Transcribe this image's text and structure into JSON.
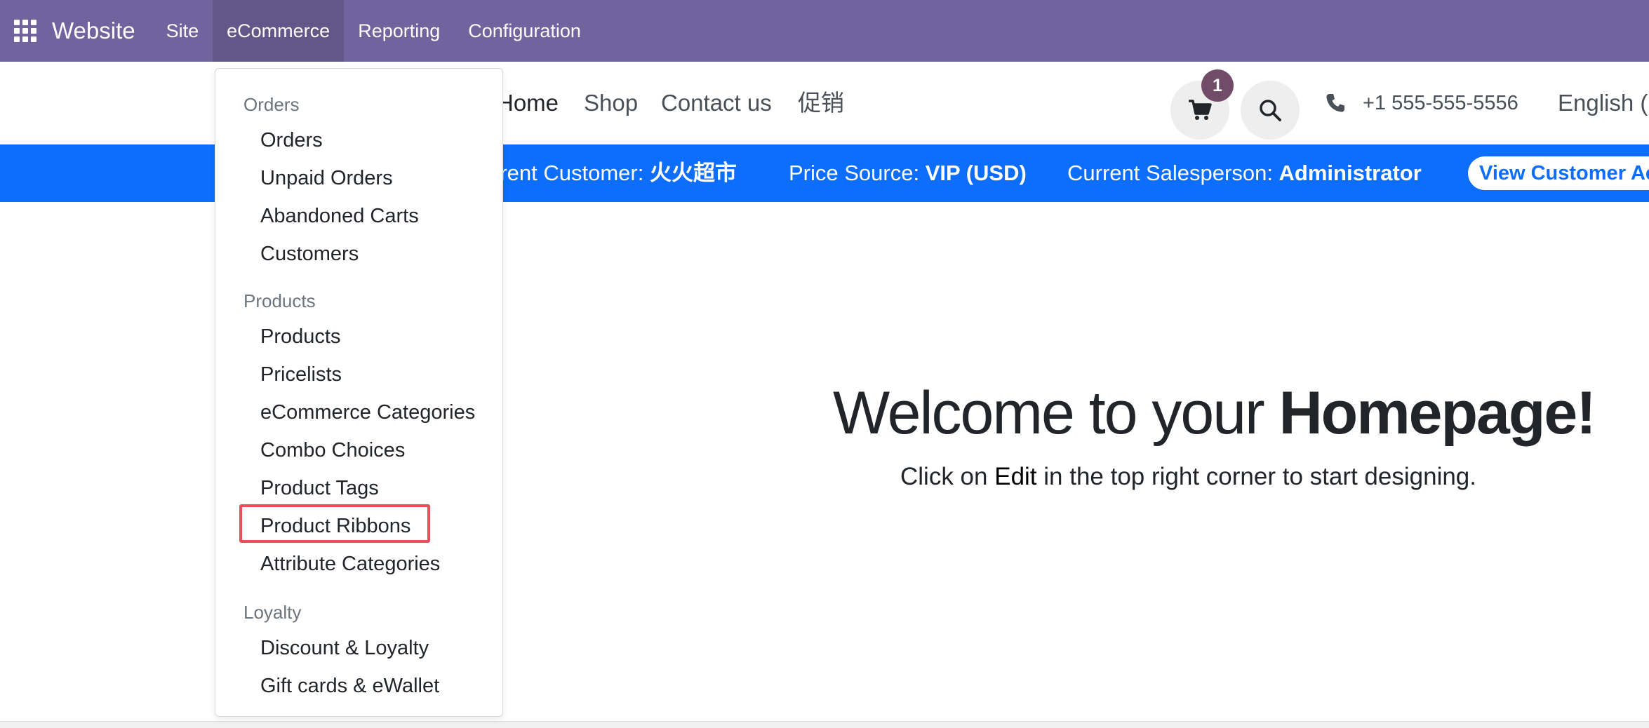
{
  "topbar": {
    "brand": "Website",
    "menus": [
      "Site",
      "eCommerce",
      "Reporting",
      "Configuration"
    ]
  },
  "header": {
    "nav": [
      "Home",
      "Shop",
      "Contact us",
      "促销"
    ],
    "cart_count": "1",
    "phone": "+1 555-555-5556",
    "language": "English ("
  },
  "info_bar": {
    "customer_label": "rrent Customer: ",
    "customer_value": "火火超市",
    "price_label": "Price Source: ",
    "price_value": "VIP (USD)",
    "salesperson_label": "Current Salesperson: ",
    "salesperson_value": "Administrator",
    "view_button": "View Customer Ac"
  },
  "main": {
    "welcome_prefix": "Welcome to your ",
    "welcome_bold": "Homepage!",
    "sub_prefix": "Click on ",
    "sub_edit": "Edit",
    "sub_suffix": " in the top right corner to start designing."
  },
  "dropdown": {
    "sections": [
      {
        "header": "Orders",
        "items": [
          "Orders",
          "Unpaid Orders",
          "Abandoned Carts",
          "Customers"
        ]
      },
      {
        "header": "Products",
        "items": [
          "Products",
          "Pricelists",
          "eCommerce Categories",
          "Combo Choices",
          "Product Tags",
          "Product Ribbons",
          "Attribute Categories"
        ]
      },
      {
        "header": "Loyalty",
        "items": [
          "Discount & Loyalty",
          "Gift cards & eWallet"
        ]
      }
    ]
  },
  "colors": {
    "topbar": "#71639e",
    "info_bar": "#0d6efd",
    "badge": "#714b67",
    "highlight": "#e9505a"
  }
}
